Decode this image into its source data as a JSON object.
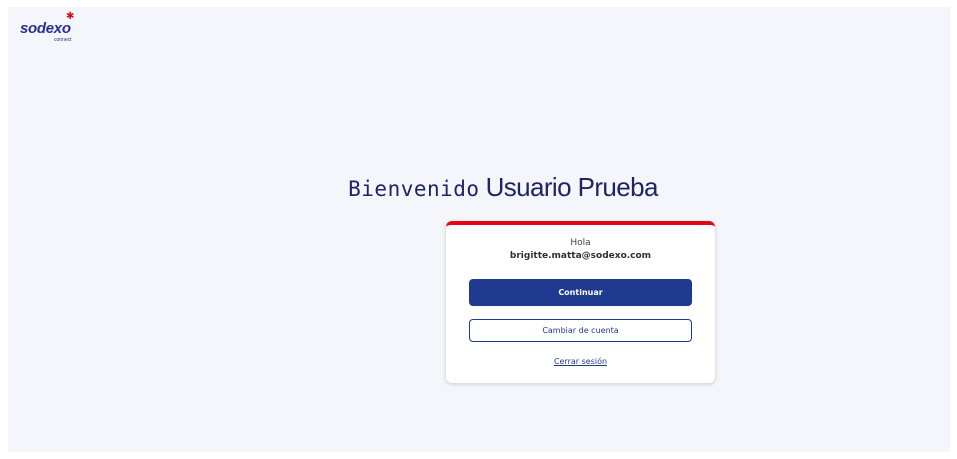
{
  "brand": {
    "name": "sodexo",
    "sub": "connect",
    "star": "✱",
    "primary_color": "#1f3a8f",
    "accent_color": "#e30613"
  },
  "welcome": {
    "greeting": "Bienvenido",
    "user_name": "Usuario Prueba"
  },
  "card": {
    "hello": "Hola",
    "email": "brigitte.matta@sodexo.com",
    "continue_label": "Continuar",
    "switch_account_label": "Cambiar de cuenta",
    "logout_label": "Cerrar sesión"
  }
}
